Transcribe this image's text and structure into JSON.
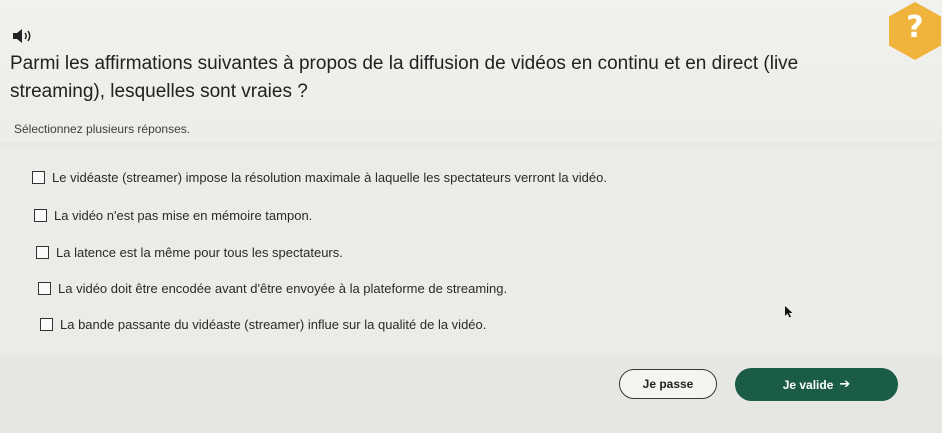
{
  "header": {
    "speaker_icon": "speaker-icon",
    "help_icon": "question-mark-icon",
    "help_symbol": "?",
    "help_color": "#f0b33b"
  },
  "question": {
    "text": "Parmi les affirmations suivantes à propos de la diffusion de vidéos en continu et en direct (live streaming), lesquelles sont vraies ?",
    "instruction": "Sélectionnez plusieurs réponses."
  },
  "options": [
    {
      "label": "Le vidéaste (streamer) impose la résolution maximale à laquelle les spectateurs verront la vidéo.",
      "checked": false
    },
    {
      "label": "La vidéo n'est pas mise en mémoire tampon.",
      "checked": false
    },
    {
      "label": "La latence est la même pour tous les spectateurs.",
      "checked": false
    },
    {
      "label": "La vidéo doit être encodée avant d'être envoyée à la plateforme de streaming.",
      "checked": false
    },
    {
      "label": "La bande passante du vidéaste (streamer) influe sur la qualité de la vidéo.",
      "checked": false
    }
  ],
  "actions": {
    "skip_label": "Je passe",
    "validate_label": "Je valide",
    "validate_arrow": "➔",
    "validate_color": "#1a5c47"
  }
}
